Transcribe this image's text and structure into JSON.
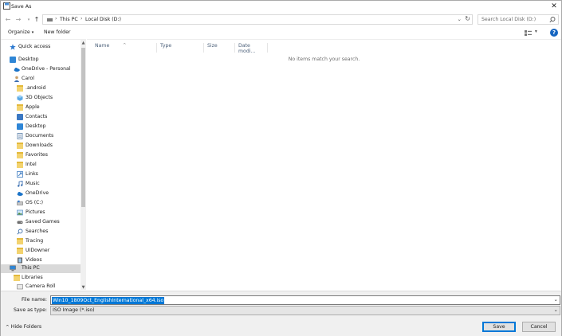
{
  "window": {
    "title": "Save As"
  },
  "address": {
    "crumbs": [
      "This PC",
      "Local Disk (D:)"
    ]
  },
  "search": {
    "placeholder": "Search Local Disk (D:)"
  },
  "toolbar": {
    "organize": "Organize",
    "new_folder": "New folder"
  },
  "tree": [
    {
      "label": "Quick access",
      "icon": "star-icon"
    },
    {
      "label": "Desktop",
      "icon": "desktop-icon"
    },
    {
      "label": "OneDrive - Personal",
      "icon": "cloud-icon"
    },
    {
      "label": "Carol",
      "icon": "user-icon"
    },
    {
      "label": ".android",
      "icon": "folder-icon"
    },
    {
      "label": "3D Objects",
      "icon": "cube-icon"
    },
    {
      "label": "Apple",
      "icon": "folder-icon"
    },
    {
      "label": "Contacts",
      "icon": "contacts-icon"
    },
    {
      "label": "Desktop",
      "icon": "desktop-icon"
    },
    {
      "label": "Documents",
      "icon": "documents-icon"
    },
    {
      "label": "Downloads",
      "icon": "downloads-icon"
    },
    {
      "label": "Favorites",
      "icon": "favorites-icon"
    },
    {
      "label": "Intel",
      "icon": "folder-icon"
    },
    {
      "label": "Links",
      "icon": "links-icon"
    },
    {
      "label": "Music",
      "icon": "music-icon"
    },
    {
      "label": "OneDrive",
      "icon": "cloud-icon"
    },
    {
      "label": "OS (C:)",
      "icon": "drive-icon"
    },
    {
      "label": "Pictures",
      "icon": "pictures-icon"
    },
    {
      "label": "Saved Games",
      "icon": "games-icon"
    },
    {
      "label": "Searches",
      "icon": "search-icon"
    },
    {
      "label": "Tracing",
      "icon": "folder-icon"
    },
    {
      "label": "UIDowner",
      "icon": "folder-icon"
    },
    {
      "label": "Videos",
      "icon": "videos-icon"
    },
    {
      "label": "This PC",
      "icon": "computer-icon"
    },
    {
      "label": "Libraries",
      "icon": "libraries-icon"
    },
    {
      "label": "Camera Roll",
      "icon": "camera-roll-icon"
    }
  ],
  "columns": [
    "Name",
    "Type",
    "Size",
    "Date modi..."
  ],
  "empty_message": "No items match your search.",
  "file_name_label": "File name:",
  "file_name_value": "Win10_1809Oct_EnglishInternational_x64.iso",
  "save_as_type_label": "Save as type:",
  "save_as_type_value": "ISO Image (*.iso)",
  "hide_folders": "Hide Folders",
  "buttons": {
    "save": "Save",
    "cancel": "Cancel"
  },
  "colors": {
    "accent": "#0078d7",
    "selection": "#d9d9d9",
    "help": "#1565c0"
  }
}
